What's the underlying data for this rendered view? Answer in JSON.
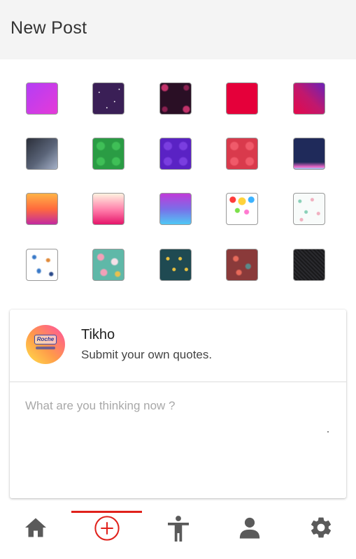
{
  "appbar": {
    "title": "New Post"
  },
  "backgrounds": [
    {
      "name": "purple-pink-gradient",
      "style": "linear-gradient(135deg,#b43ef5 0%,#e53ad8 100%)"
    },
    {
      "name": "starry-night",
      "style": "radial-gradient(circle at 20% 30%,#fff 0.6px,transparent 1.2px),radial-gradient(circle at 70% 60%,#fff 0.6px,transparent 1.2px),radial-gradient(circle at 45% 80%,#fff 0.6px,transparent 1.2px),radial-gradient(circle at 85% 20%,#fff 0.6px,transparent 1.2px),#3a1f56"
    },
    {
      "name": "dark-floral",
      "style": "radial-gradient(circle at 15% 15%,#c2326a 4px,transparent 6px),radial-gradient(circle at 85% 85%,#c2326a 4px,transparent 6px),radial-gradient(circle at 85% 15%,#8a2050 3px,transparent 5px),radial-gradient(circle at 15% 85%,#8a2050 3px,transparent 5px),#2a0f25"
    },
    {
      "name": "crimson-solid",
      "style": "#e5003a"
    },
    {
      "name": "violet-red-gradient",
      "style": "linear-gradient(45deg,#e5094b 0%,#c0186e 50%,#6a22b8 100%)"
    },
    {
      "name": "slate-gradient",
      "style": "linear-gradient(135deg,#2b2f3a 0%,#5a6478 55%,#a6b2c8 100%)"
    },
    {
      "name": "green-hearts",
      "style": "radial-gradient(circle at 25% 25%,#3fbf57 5px,transparent 7px),radial-gradient(circle at 75% 25%,#3fbf57 5px,transparent 7px),radial-gradient(circle at 25% 75%,#3fbf57 5px,transparent 7px),radial-gradient(circle at 75% 75%,#3fbf57 5px,transparent 7px),#2a9c44"
    },
    {
      "name": "purple-hearts",
      "style": "radial-gradient(circle at 25% 25%,#7a3ee0 5px,transparent 7px),radial-gradient(circle at 75% 25%,#7a3ee0 5px,transparent 7px),radial-gradient(circle at 25% 75%,#7a3ee0 5px,transparent 7px),radial-gradient(circle at 75% 75%,#7a3ee0 5px,transparent 7px),#5a22c4"
    },
    {
      "name": "red-hearts",
      "style": "radial-gradient(circle at 25% 25%,#f05a6a 5px,transparent 7px),radial-gradient(circle at 75% 25%,#f05a6a 5px,transparent 7px),radial-gradient(circle at 25% 75%,#f05a6a 5px,transparent 7px),radial-gradient(circle at 75% 75%,#f05a6a 5px,transparent 7px),#d93a4c"
    },
    {
      "name": "navy-hands",
      "style": "linear-gradient(0deg,#8fd0f0 0px,#f06acc 3px,transparent 10px),#1f2a5a"
    },
    {
      "name": "orange-magenta-gradient",
      "style": "linear-gradient(180deg,#ffb347 0%,#ff6a3d 50%,#c22aa0 100%)"
    },
    {
      "name": "cream-pink-gradient",
      "style": "linear-gradient(180deg,#fff3e0 0%,#ff7aa8 55%,#e5156a 100%)"
    },
    {
      "name": "purple-blue-gradient",
      "style": "linear-gradient(180deg,#c03ad8 0%,#7a6ee8 50%,#4fc8f5 100%)"
    },
    {
      "name": "paint-splash",
      "style": "radial-gradient(circle at 20% 20%,#ff3b3b 4px,transparent 5px),radial-gradient(circle at 50% 25%,#ffd23b 5px,transparent 6px),radial-gradient(circle at 80% 20%,#3bb2ff 4px,transparent 5px),radial-gradient(circle at 35% 55%,#7ce04a 3px,transparent 4px),radial-gradient(circle at 65% 60%,#ff7ad0 3px,transparent 4px),#ffffff"
    },
    {
      "name": "pastel-drops",
      "style": "radial-gradient(circle at 20% 25%,#8ad0b8 2px,transparent 3px),radial-gradient(circle at 60% 20%,#f0b0c0 2px,transparent 3px),radial-gradient(circle at 40% 60%,#8ad0b8 2px,transparent 3px),radial-gradient(circle at 80% 65%,#f0b0c0 2px,transparent 3px),radial-gradient(circle at 25% 85%,#f0b0c0 2px,transparent 3px),#f8fbfa"
    },
    {
      "name": "feather-pattern",
      "style": "radial-gradient(ellipse at 25% 25%,#3a7ac8 2px,transparent 4px),radial-gradient(ellipse at 70% 35%,#e08a3a 2px,transparent 4px),radial-gradient(ellipse at 40% 70%,#3a7ac8 2px,transparent 4px),radial-gradient(ellipse at 80% 80%,#2a4a8a 2px,transparent 4px),#ffffff"
    },
    {
      "name": "teal-floral",
      "style": "radial-gradient(circle at 25% 25%,#f2a0b8 4px,transparent 6px),radial-gradient(circle at 70% 40%,#f5e0e8 4px,transparent 6px),radial-gradient(circle at 35% 75%,#f2a0b8 4px,transparent 6px),radial-gradient(circle at 80% 80%,#e8c050 3px,transparent 5px),#5fb8a8"
    },
    {
      "name": "teal-scales",
      "style": "radial-gradient(circle at 25% 30%,#e8c040 2px,transparent 3px),radial-gradient(circle at 65% 30%,#e8c040 2px,transparent 3px),radial-gradient(circle at 45% 65%,#e8c040 2px,transparent 3px),radial-gradient(circle at 85% 65%,#e8c040 2px,transparent 3px),#1f4a52"
    },
    {
      "name": "red-doodle",
      "style": "radial-gradient(circle at 30% 30%,#e86a5a 3px,transparent 5px),radial-gradient(circle at 70% 55%,#5a8a8a 3px,transparent 5px),radial-gradient(circle at 40% 75%,#e86a5a 3px,transparent 5px),#8a3a3a"
    },
    {
      "name": "black-texture",
      "style": "repeating-linear-gradient(45deg,#2a2a2e 0px,#2a2a2e 2px,#1a1a1c 2px,#1a1a1c 4px)"
    }
  ],
  "composer": {
    "user_name": "Tikho",
    "user_subtitle": "Submit your own quotes.",
    "placeholder": "What are you thinking now ?",
    "avatar_text": "Roche"
  },
  "nav": {
    "active_color": "#e0211b",
    "icon_color": "#5a5a5a",
    "items": [
      {
        "name": "home",
        "icon": "home-icon"
      },
      {
        "name": "new-post",
        "icon": "add-circle-icon",
        "active": true
      },
      {
        "name": "accessibility",
        "icon": "accessibility-icon"
      },
      {
        "name": "profile",
        "icon": "person-icon"
      },
      {
        "name": "settings",
        "icon": "gear-icon"
      }
    ]
  }
}
